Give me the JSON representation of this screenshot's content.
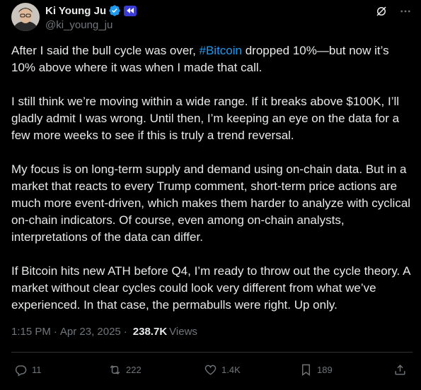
{
  "author": {
    "display_name": "Ki Young Ju",
    "handle": "@ki_young_ju"
  },
  "header": {
    "icons": [
      "verified-icon",
      "org-badge-icon",
      "grok-icon",
      "more-icon"
    ]
  },
  "tweet": {
    "p1_before": "After I said the bull cycle was over, ",
    "p1_hashtag": "#Bitcoin",
    "p1_after": " dropped 10%—but now it’s 10% above where it was when I made that call.",
    "p2": "I still think we’re moving within a wide range. If it breaks above $100K, I’ll gladly admit I was wrong. Until then, I’m keeping an eye on the data for a few more weeks to see if this is truly a trend reversal.",
    "p3": "My focus is on long-term supply and demand using on-chain data. But in a market that reacts to every Trump comment, short-term price actions are much more event-driven, which makes them harder to analyze with cyclical on-chain indicators. Of course, even among on-chain analysts, interpretations of the data can differ.",
    "p4": "If Bitcoin hits new ATH before Q4, I’m ready to throw out the cycle theory. A market without clear cycles could look very different from what we’ve experienced. In that case, the permabulls were right. Up only."
  },
  "meta": {
    "time": "1:15 PM",
    "separator1": "·",
    "date": "Apr 23, 2025",
    "separator2": "·",
    "views_count": "238.7K",
    "views_label": "Views"
  },
  "actions": {
    "replies": "11",
    "reposts": "222",
    "likes": "1.4K",
    "bookmarks": "189"
  },
  "colors": {
    "background": "#000000",
    "text": "#e7e9ea",
    "muted": "#71767b",
    "accent": "#1d9bf0"
  }
}
